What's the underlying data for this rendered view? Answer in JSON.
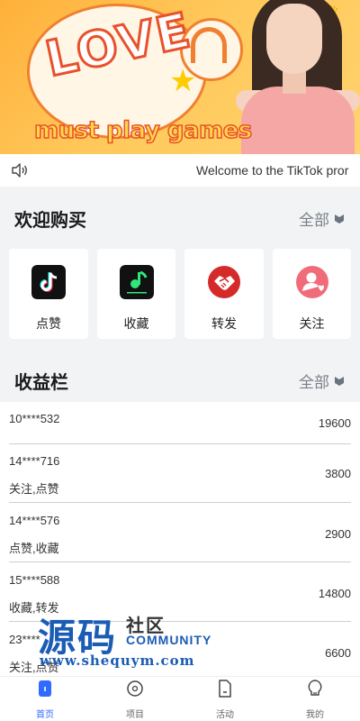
{
  "banner": {
    "headline": "LOVE",
    "tagline": "must play games"
  },
  "notice": {
    "icon": "speaker-icon",
    "message": "Welcome to the TikTok pror"
  },
  "purchase_section": {
    "title": "欢迎购买",
    "more_label": "全部",
    "items": [
      {
        "label": "点赞",
        "icon": "tiktok-icon"
      },
      {
        "label": "收藏",
        "icon": "music-app-icon"
      },
      {
        "label": "转发",
        "icon": "handshake-icon"
      },
      {
        "label": "关注",
        "icon": "user-heart-icon"
      }
    ]
  },
  "earnings_section": {
    "title": "收益栏",
    "more_label": "全部",
    "rows": [
      {
        "user": "10****532",
        "tags": "",
        "amount": "19600"
      },
      {
        "user": "14****716",
        "tags": "关注,点赞",
        "amount": "3800"
      },
      {
        "user": "14****576",
        "tags": "点赞,收藏",
        "amount": "2900"
      },
      {
        "user": "15****588",
        "tags": "收藏,转发",
        "amount": "14800"
      },
      {
        "user": "23****",
        "tags": "关注,点赞",
        "amount": "6600"
      }
    ]
  },
  "watermark": {
    "big": "源码",
    "she": "社区",
    "community": "COMMUNITY",
    "url": "www.shequym.com"
  },
  "tabbar": {
    "tabs": [
      {
        "label": "首页",
        "icon": "home-icon",
        "active": true
      },
      {
        "label": "项目",
        "icon": "project-icon",
        "active": false
      },
      {
        "label": "活动",
        "icon": "activity-icon",
        "active": false
      },
      {
        "label": "我的",
        "icon": "profile-icon",
        "active": false
      }
    ]
  },
  "colors": {
    "accent": "#2f6bff",
    "watermark": "#1b5cb5"
  }
}
